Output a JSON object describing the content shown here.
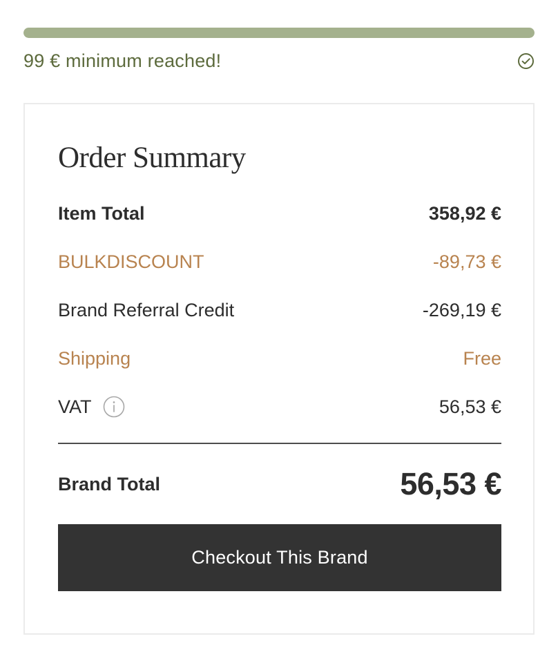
{
  "progress": {
    "fraction": 1,
    "message": "99 € minimum reached!",
    "status_icon": "check-circle-icon"
  },
  "order_summary": {
    "title": "Order Summary",
    "rows": [
      {
        "label": "Item Total",
        "value": "358,92 €"
      },
      {
        "label": "BULKDISCOUNT",
        "value": "-89,73 €"
      },
      {
        "label": "Brand Referral Credit",
        "value": "-269,19 €"
      },
      {
        "label": "Shipping",
        "value": "Free"
      },
      {
        "label": "VAT",
        "value": "56,53 €",
        "icon": "info-icon"
      }
    ],
    "brand_total": {
      "label": "Brand Total",
      "value": "56,53 €"
    },
    "checkout_label": "Checkout This Brand"
  },
  "colors": {
    "progress_fill": "#a4b18d",
    "success_text": "#5d6b3d",
    "discount_text": "#b8834f",
    "button_background": "#333333"
  }
}
